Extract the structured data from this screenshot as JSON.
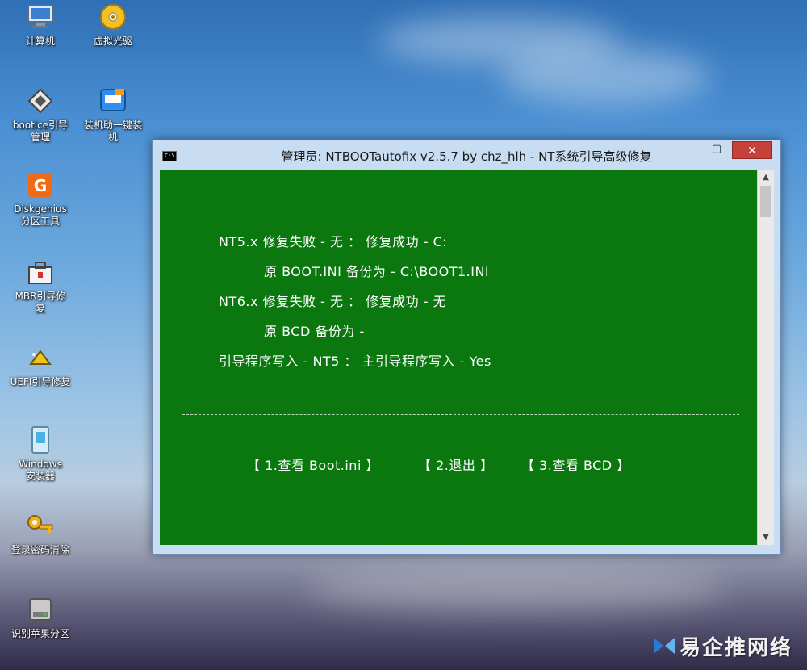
{
  "desktop": {
    "icons": [
      {
        "label": "计算机"
      },
      {
        "label": "虚拟光驱"
      },
      {
        "label": "bootice引导\n管理"
      },
      {
        "label": "装机助一键装\n机"
      },
      {
        "label": "Diskgenius\n分区工具"
      },
      {
        "label": "MBR引导修\n复"
      },
      {
        "label": "UEFI引导修复"
      },
      {
        "label": "Windows\n安装器"
      },
      {
        "label": "登录密码清除"
      },
      {
        "label": "识别苹果分区"
      }
    ],
    "watermark": "易企推网络"
  },
  "window": {
    "app_icon_text": "C:\\",
    "title": "管理员:  NTBOOTautofix v2.5.7 by chz_hlh - NT系统引导高级修复",
    "minimize_glyph": "–",
    "maximize_glyph": "▢",
    "close_glyph": "✕",
    "console": {
      "lines": [
        "NT5.x 修复失败 - 无 ：     修复成功 - C:",
        "原 BOOT.INI 备份为 - C:\\BOOT1.INI",
        "NT6.x 修复失败 - 无 ：     修复成功 - 无",
        "原 BCD 备份为 -",
        "引导程序写入 - NT5  ：     主引导程序写入 - Yes"
      ],
      "menu": {
        "opt1": "【 1.查看 Boot.ini 】",
        "opt2": "【 2.退出 】",
        "opt3": "【    3.查看  BCD   】"
      }
    },
    "scroll_up": "▲",
    "scroll_down": "▼"
  },
  "colors": {
    "console_bg": "#0b780f",
    "close_button": "#c7403a"
  }
}
